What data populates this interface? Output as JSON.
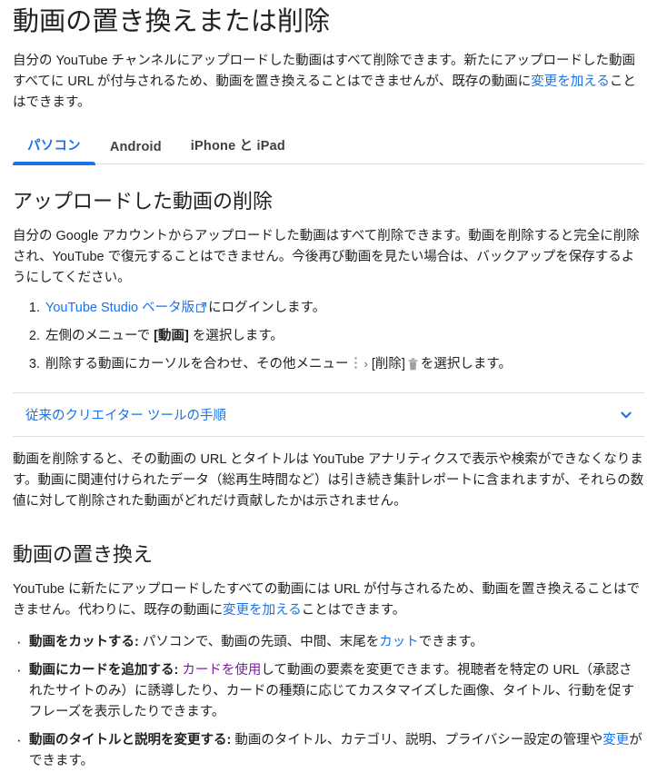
{
  "page": {
    "title": "動画の置き換えまたは削除",
    "intro": {
      "part1": "自分の YouTube チャンネルにアップロードした動画はすべて削除できます。新たにアップロードした動画すべてに URL が付与されるため、動画を置き換えることはできませんが、既存の動画に",
      "link": "変更を加える",
      "part2": "ことはできます。"
    }
  },
  "tabs": {
    "items": [
      {
        "label": "パソコン",
        "active": true
      },
      {
        "label": "Android",
        "active": false
      },
      {
        "label": "iPhone と iPad",
        "active": false
      }
    ]
  },
  "section_delete": {
    "heading": "アップロードした動画の削除",
    "paragraph": "自分の Google アカウントからアップロードした動画はすべて削除できます。動画を削除すると完全に削除され、YouTube で復元することはできません。今後再び動画を見たい場合は、バックアップを保存するようにしてください。",
    "steps": [
      {
        "link": "YouTube Studio ベータ版",
        "icon": "external-link-icon",
        "text_after": "にログインします。"
      },
      {
        "text_before": "左側のメニューで",
        "bold": "[動画]",
        "text_after": "を選択します。"
      },
      {
        "text_before": "削除する動画にカーソルを合わせ、その他メニュー",
        "icon_menu": "more-vert-icon",
        "separator": "›",
        "bracket": "[削除]",
        "icon_trash": "trash-icon",
        "text_after": "を選択します。"
      }
    ],
    "expander": {
      "label": "従来のクリエイター ツールの手順",
      "chevron": "chevron-down-icon"
    },
    "note": "動画を削除すると、その動画の URL とタイトルは YouTube アナリティクスで表示や検索ができなくなります。動画に関連付けられたデータ（総再生時間など）は引き続き集計レポートに含まれますが、それらの数値に対して削除された動画がどれだけ貢献したかは示されません。"
  },
  "section_replace": {
    "heading": "動画の置き換え",
    "paragraph": {
      "part1": "YouTube に新たにアップロードしたすべての動画には URL が付与されるため、動画を置き換えることはできません。代わりに、既存の動画に",
      "link": "変更を加える",
      "part2": "ことはできます。"
    },
    "bullets": [
      {
        "bold": "動画をカットする:",
        "text1": "パソコンで、動画の先頭、中間、末尾を",
        "link": "カット",
        "link_visited": false,
        "text2": "できます。"
      },
      {
        "bold": "動画にカードを追加する:",
        "text1": "",
        "link": "カードを使用",
        "link_visited": true,
        "text2": "して動画の要素を変更できます。視聴者を特定の URL（承認されたサイトのみ）に誘導したり、カードの種類に応じてカスタマイズした画像、タイトル、行動を促すフレーズを表示したりできます。"
      },
      {
        "bold": "動画のタイトルと説明を変更する:",
        "text1": "動画のタイトル、カテゴリ、説明、プライバシー設定の管理や",
        "link": "変更",
        "link_visited": false,
        "text2": "ができます。"
      }
    ]
  },
  "colors": {
    "link": "#1a73e8",
    "link_visited": "#7b1fa2",
    "text": "#212121",
    "divider": "#e0e0e0",
    "icon_gray": "#5f6368"
  }
}
